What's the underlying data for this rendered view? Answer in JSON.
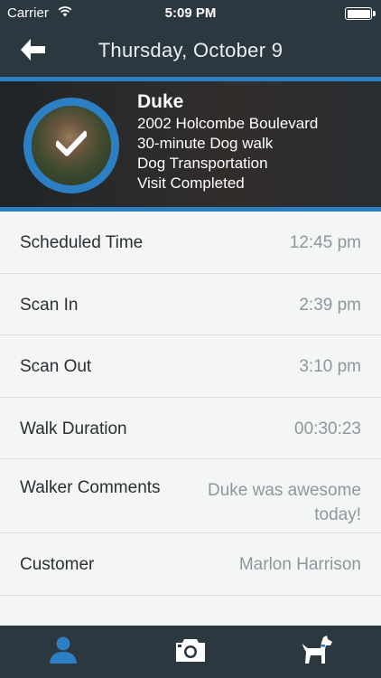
{
  "status_bar": {
    "carrier": "Carrier",
    "time": "5:09 PM",
    "wifi_icon": "wifi-icon",
    "battery_icon": "battery-icon"
  },
  "nav": {
    "title": "Thursday, October 9",
    "back_icon": "back-arrow-icon"
  },
  "visit": {
    "dog_name": "Duke",
    "address": "2002 Holcombe Boulevard",
    "service": "30-minute Dog walk",
    "extra": "Dog Transportation",
    "status": "Visit Completed",
    "status_icon": "checkmark-icon"
  },
  "details": [
    {
      "label": "Scheduled Time",
      "value": "12:45 pm"
    },
    {
      "label": "Scan In",
      "value": "2:39 pm"
    },
    {
      "label": "Scan Out",
      "value": "3:10 pm"
    },
    {
      "label": "Walk Duration",
      "value": "00:30:23"
    },
    {
      "label": "Walker Comments",
      "value": "Duke was awesome today!"
    },
    {
      "label": "Customer",
      "value": "Marlon Harrison"
    }
  ],
  "tabs": [
    {
      "icon": "person-icon",
      "active": true
    },
    {
      "icon": "camera-icon",
      "active": false
    },
    {
      "icon": "dog-icon",
      "active": false
    }
  ],
  "colors": {
    "bar_background": "#2c3840",
    "accent_blue": "#2c7fc3",
    "page_background": "#f4f5f5",
    "value_gray": "#8f979c"
  }
}
